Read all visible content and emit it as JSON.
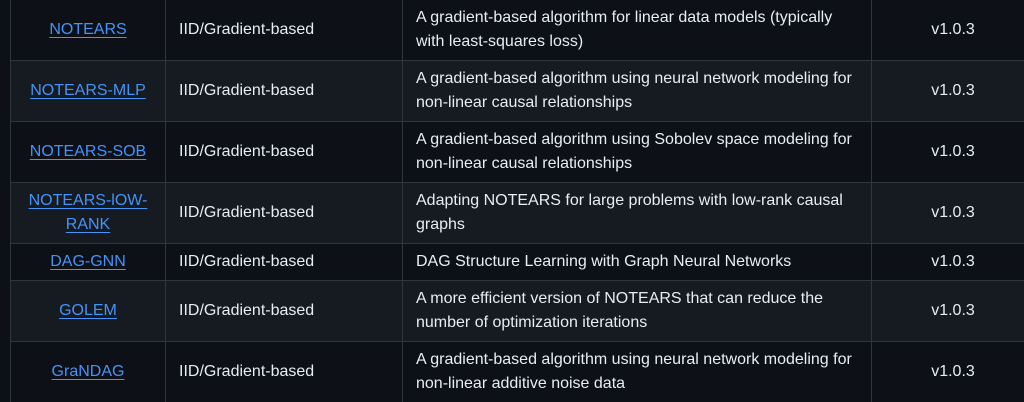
{
  "rows": [
    {
      "name": "NOTEARS",
      "category": "IID/Gradient-based",
      "description": "A gradient-based algorithm for linear data models (typically with least-squares loss)",
      "version": "v1.0.3"
    },
    {
      "name": "NOTEARS-MLP",
      "category": "IID/Gradient-based",
      "description": "A gradient-based algorithm using neural network modeling for non-linear causal relationships",
      "version": "v1.0.3"
    },
    {
      "name": "NOTEARS-SOB",
      "category": "IID/Gradient-based",
      "description": "A gradient-based algorithm using Sobolev space modeling for non-linear causal relationships",
      "version": "v1.0.3"
    },
    {
      "name": "NOTEARS-lOW-RANK",
      "category": "IID/Gradient-based",
      "description": "Adapting NOTEARS for large problems with low-rank causal graphs",
      "version": "v1.0.3"
    },
    {
      "name": "DAG-GNN",
      "category": "IID/Gradient-based",
      "description": "DAG Structure Learning with Graph Neural Networks",
      "version": "v1.0.3"
    },
    {
      "name": "GOLEM",
      "category": "IID/Gradient-based",
      "description": "A more efficient version of NOTEARS that can reduce the number of optimization iterations",
      "version": "v1.0.3"
    },
    {
      "name": "GraNDAG",
      "category": "IID/Gradient-based",
      "description": "A gradient-based algorithm using neural network modeling for non-linear additive noise data",
      "version": "v1.0.3"
    }
  ],
  "colors": {
    "background": "#0d1117",
    "row_alt": "#161b22",
    "border": "#30363d",
    "text": "#e6edf3",
    "link": "#4493f8"
  }
}
